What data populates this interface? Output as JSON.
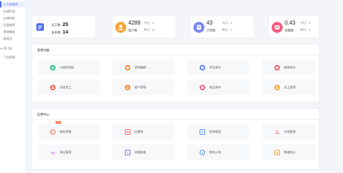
{
  "sidebar": {
    "active": {
      "label": "个性推荐"
    },
    "items": [
      {
        "label": "店铺页面"
      },
      {
        "label": "店铺导航"
      },
      {
        "label": "运营推荐"
      },
      {
        "label": "营销模板"
      },
      {
        "label": "推客页"
      },
      {
        "label": "多门店"
      },
      {
        "label": "门店管理"
      }
    ]
  },
  "stats": {
    "card1": {
      "label1": "员工数:",
      "value1": "25",
      "label2": "发布数:",
      "value2": "14",
      "color": "#4c6bf5"
    },
    "card2": {
      "value": "4289",
      "label": "客户数",
      "today": "今日：0",
      "yesterday": "昨日：87",
      "color": "#f7a53a"
    },
    "card3": {
      "value": "43",
      "label": "订单数",
      "today": "今日：0",
      "yesterday": "昨日：0",
      "color": "#7a86f0"
    },
    "card4": {
      "value": "0.43",
      "label": "金额数",
      "today": "今日：0",
      "yesterday": "昨日：0",
      "color": "#f35b7a"
    }
  },
  "common": {
    "title": "常用功能",
    "tiles": [
      {
        "label": "小程序授权",
        "icon": "miniapp-icon",
        "color": "#35c58c"
      },
      {
        "label": "官网编辑",
        "icon": "website-icon",
        "color": "#f7883a"
      },
      {
        "label": "项目发布",
        "icon": "project-icon",
        "color": "#5c7cf5"
      },
      {
        "label": "新闻发布",
        "icon": "news-icon",
        "color": "#f35b7a"
      },
      {
        "label": "添加员工",
        "icon": "add-staff-icon",
        "color": "#f36b5b"
      },
      {
        "label": "客户管理",
        "icon": "customer-icon",
        "color": "#f7883a"
      },
      {
        "label": "商品发布",
        "icon": "product-icon",
        "color": "#f35b7a"
      },
      {
        "label": "员工管理",
        "icon": "staff-icon",
        "color": "#f7a53a"
      }
    ]
  },
  "apps": {
    "title": "应用中心",
    "hot_badge": "HOT",
    "tiles": [
      {
        "label": "微信直播",
        "icon": "live-icon",
        "color": "#f36b5b",
        "hot": true
      },
      {
        "label": "优惠券",
        "icon": "coupon-icon",
        "color": "#f35b5b"
      },
      {
        "label": "表单管理",
        "icon": "form-icon",
        "color": "#4c8bf5"
      },
      {
        "label": "分销管理",
        "icon": "distribution-icon",
        "color": "#f36b5b"
      },
      {
        "label": "多区管理",
        "icon": "multi-area-icon",
        "color": "#c04fd8"
      },
      {
        "label": "流量查看",
        "icon": "traffic-icon",
        "color": "#7a6bf0"
      },
      {
        "label": "商机公海",
        "icon": "opportunity-icon",
        "color": "#4c8bf5"
      },
      {
        "label": "数据统计",
        "icon": "statistics-icon",
        "color": "#f7a53a"
      }
    ]
  }
}
